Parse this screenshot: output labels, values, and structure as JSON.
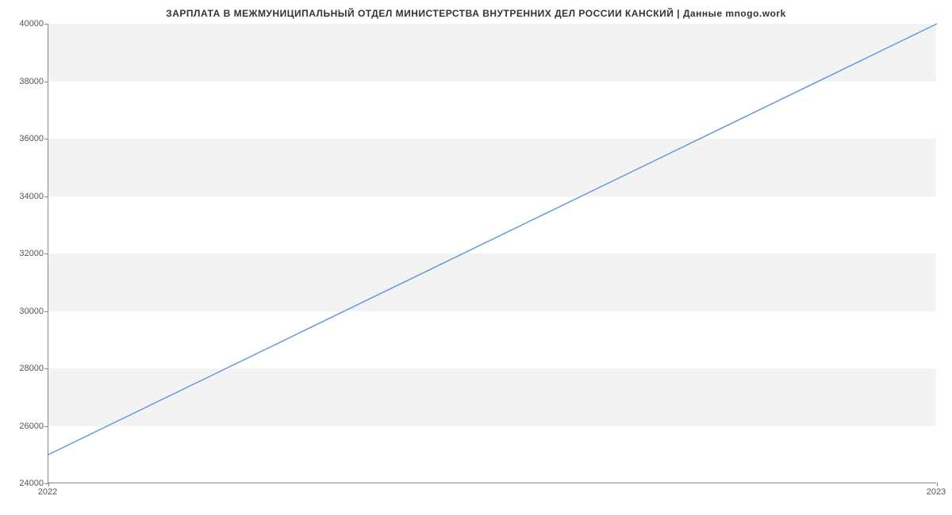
{
  "chart_data": {
    "type": "line",
    "title": "ЗАРПЛАТА В МЕЖМУНИЦИПАЛЬНЫЙ ОТДЕЛ МИНИСТЕРСТВА ВНУТРЕННИХ ДЕЛ РОССИИ КАНСКИЙ | Данные mnogo.work",
    "x": [
      "2022",
      "2023"
    ],
    "values": [
      25000,
      40000
    ],
    "xlabel": "",
    "ylabel": "",
    "ylim": [
      24000,
      40000
    ],
    "y_ticks": [
      24000,
      26000,
      28000,
      30000,
      32000,
      34000,
      36000,
      38000,
      40000
    ],
    "x_ticks": [
      "2022",
      "2023"
    ],
    "grid": true,
    "line_color": "#6699dd"
  }
}
